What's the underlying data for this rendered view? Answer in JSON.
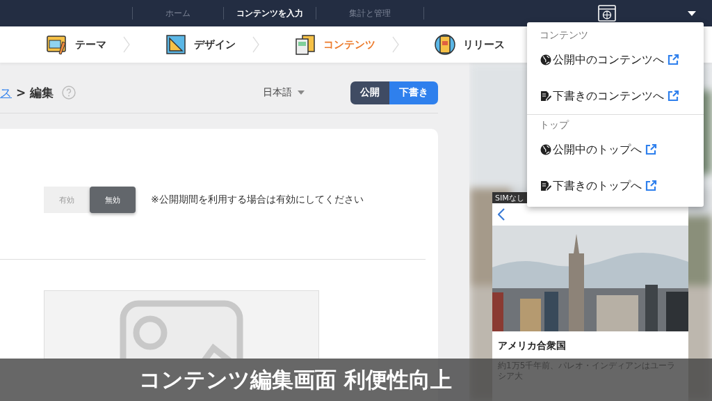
{
  "top_nav": {
    "items": [
      {
        "label": "ホーム",
        "selected": false
      },
      {
        "label": "コンテンツを入力",
        "selected": true
      },
      {
        "label": "集計と管理",
        "selected": false
      }
    ]
  },
  "steps": [
    {
      "label": "テーマ",
      "selected": false
    },
    {
      "label": "デザイン",
      "selected": false
    },
    {
      "label": "コンテンツ",
      "selected": true
    },
    {
      "label": "リリース",
      "selected": false
    }
  ],
  "breadcrumb": {
    "link": "ス",
    "separator": ">",
    "current": "編集"
  },
  "language": "日本語",
  "publish_switch": [
    {
      "label": "公開",
      "selected": false
    },
    {
      "label": "下書き",
      "selected": true
    }
  ],
  "period_toggle": {
    "options": [
      {
        "label": "有効",
        "selected": false
      },
      {
        "label": "無効",
        "selected": true
      }
    ],
    "note": "※公開期間を利用する場合は有効にしてください"
  },
  "preview_menu": {
    "sections": [
      {
        "title": "コンテンツ",
        "items": [
          {
            "kind": "public",
            "label": "公開中のコンテンツへ"
          },
          {
            "kind": "draft",
            "label": "下書きのコンテンツへ"
          }
        ]
      },
      {
        "title": "トップ",
        "items": [
          {
            "kind": "public",
            "label": "公開中のトップへ"
          },
          {
            "kind": "draft",
            "label": "下書きのトップへ"
          }
        ]
      }
    ]
  },
  "phone_preview": {
    "status": "SIMなし",
    "article_title": "アメリカ合衆国",
    "body": "約1万5千年前、パレオ・インディアンはユーラシア大"
  },
  "caption": "コンテンツ編集画面 利便性向上"
}
